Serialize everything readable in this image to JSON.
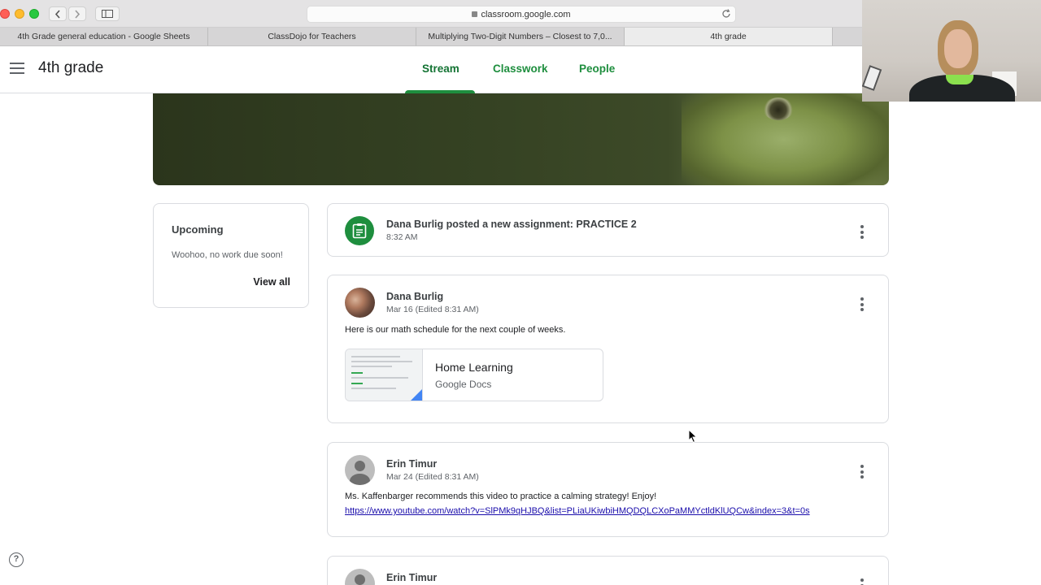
{
  "browser": {
    "url": "classroom.google.com",
    "tabs": [
      {
        "label": "4th Grade general education - Google Sheets",
        "active": false
      },
      {
        "label": "ClassDojo for Teachers",
        "active": false
      },
      {
        "label": "Multiplying Two-Digit Numbers – Closest to 7,0...",
        "active": false
      },
      {
        "label": "4th grade",
        "active": true
      }
    ]
  },
  "header": {
    "class_title": "4th grade",
    "nav": [
      "Stream",
      "Classwork",
      "People"
    ],
    "active_nav": "Stream"
  },
  "upcoming": {
    "title": "Upcoming",
    "message": "Woohoo, no work due soon!",
    "view_all": "View all"
  },
  "stream": [
    {
      "type": "assignment",
      "title": "Dana Burlig posted a new assignment: PRACTICE 2",
      "time": "8:32 AM"
    },
    {
      "type": "announcement",
      "author": "Dana Burlig",
      "date": "Mar 16 (Edited 8:31 AM)",
      "text": "Here is our math schedule for the next couple of weeks.",
      "attachment": {
        "title": "Home Learning",
        "source": "Google Docs"
      }
    },
    {
      "type": "announcement",
      "author": "Erin Timur",
      "date": "Mar 24 (Edited 8:31 AM)",
      "text": "Ms. Kaffenbarger recommends this video to practice a calming strategy! Enjoy!",
      "link": "https://www.youtube.com/watch?v=SlPMk9qHJBQ&list=PLiaUKiwbiHMQDQLCXoPaMMYctldKlUQCw&index=3&t=0s"
    },
    {
      "type": "announcement",
      "author": "Erin Timur"
    }
  ],
  "icons": {
    "menu": "hamburger-menu-icon",
    "assignment": "assignment-icon",
    "more": "more-vert-icon",
    "help": "help-icon"
  },
  "colors": {
    "brand_green": "#1e8e3e",
    "link_blue": "#1a0dab"
  }
}
